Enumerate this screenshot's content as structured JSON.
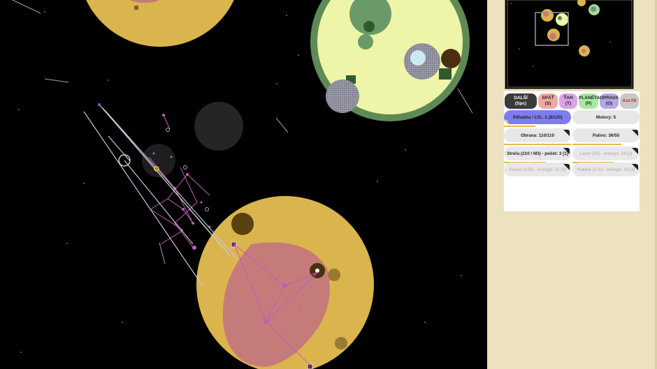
{
  "toolbar": [
    {
      "label": "DALŠÍ",
      "key": "(Spc)",
      "color": "#3a3a3a",
      "text": "#ffffff"
    },
    {
      "label": "SPÄŤ",
      "key": "(S)",
      "color": "#f0a8a0",
      "text": "#222222"
    },
    {
      "label": "ŤAH",
      "key": "(T)",
      "color": "#d8a4e8",
      "text": "#222222"
    },
    {
      "label": "PLANÉTA",
      "key": "(P)",
      "color": "#a8e8a0",
      "text": "#222222"
    },
    {
      "label": "OPRAVA",
      "key": "(O)",
      "color": "#b4a8e8",
      "text": "#222222"
    },
    {
      "label": "Aut.fill",
      "key": "",
      "color": "#c8c8c8",
      "text": "#e02020"
    }
  ],
  "ship_stats": {
    "ship": "Stíhačka / LVL. 1 (8/120)",
    "motors": "Motory: 5",
    "defense": "Obrana: 110/110",
    "fuel": "Palivo: 36/50",
    "weapon1": "Streľa (210 / M3) - počet: 3  [1]",
    "weapon2": "Laser (20) - energia: 24  [2]",
    "weapon3": "Kanón (125) - energia: 22  [3]",
    "weapon4": "Raketa (175) - energia: 24  [4]"
  },
  "colors": {
    "background": "#000000",
    "sidebar": "#ede2c0",
    "planet_yellow": "#dab54d",
    "planet_pale": "#eef5a8",
    "planet_ring": "#5e8a55",
    "territory_pink": "#c67b7b",
    "fleet_magenta": "#c45ab8",
    "selected_ship_tab": "#7d7df0"
  }
}
